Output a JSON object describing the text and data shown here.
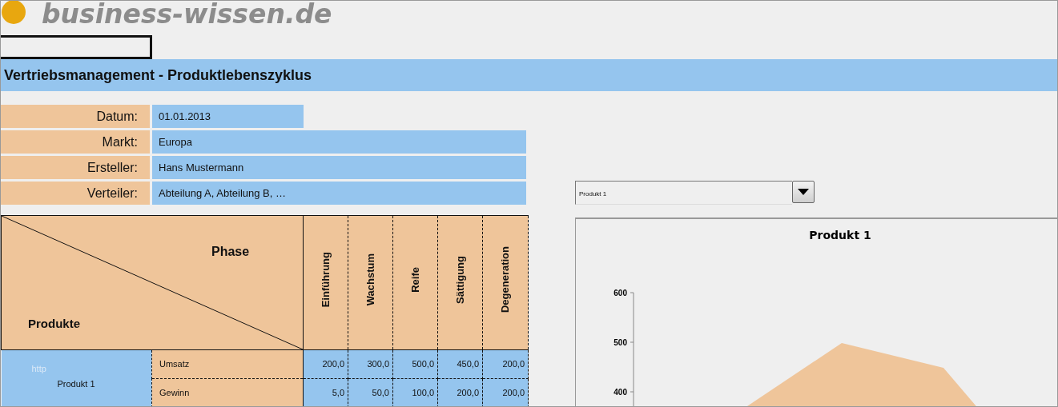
{
  "logo": {
    "text": "business-wissen.de"
  },
  "title_bar": {
    "title": "Vertriebsmanagement - Produktlebenszyklus"
  },
  "form": [
    {
      "label": "Datum:",
      "value": "01.01.2013",
      "kind": "short"
    },
    {
      "label": "Markt:",
      "value": "Europa",
      "kind": "long"
    },
    {
      "label": "Ersteller:",
      "value": "Hans Mustermann",
      "kind": "long"
    },
    {
      "label": "Verteiler:",
      "value": "Abteilung A, Abteilung B, …",
      "kind": "long"
    }
  ],
  "table": {
    "row_header": "Produkte",
    "column_header": "Phase",
    "phases": [
      "Einführung",
      "Wachstum",
      "Reife",
      "Sättigung",
      "Degeneration"
    ],
    "products": [
      {
        "name": "Produkt 1",
        "note": "http",
        "rows": [
          {
            "metric": "Umsatz",
            "values": [
              "200,0",
              "300,0",
              "500,0",
              "450,0",
              "200,0"
            ]
          },
          {
            "metric": "Gewinn",
            "values": [
              "5,0",
              "50,0",
              "100,0",
              "200,0",
              "200,0"
            ]
          }
        ]
      }
    ]
  },
  "product_select": {
    "value": "Produkt 1"
  },
  "chart": {
    "title": "Produkt 1",
    "y_ticks": [
      "600",
      "500",
      "400"
    ]
  }
}
